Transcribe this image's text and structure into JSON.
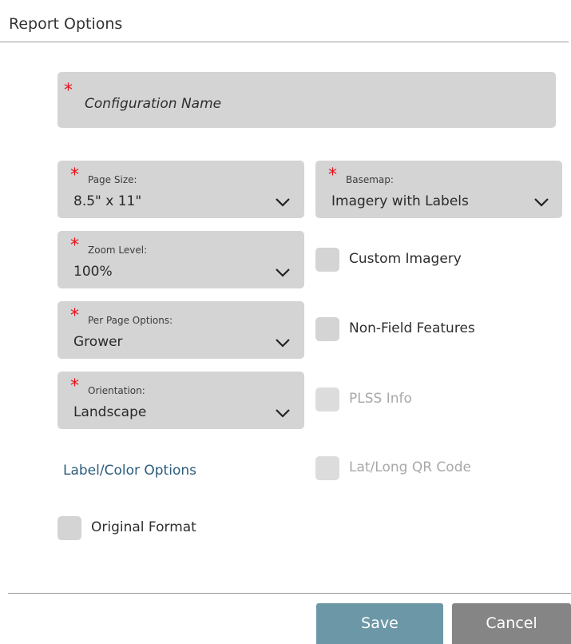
{
  "header": {
    "title": "Report Options"
  },
  "fields": {
    "config_name": {
      "required_mark": "*",
      "placeholder": "Configuration Name"
    },
    "page_size": {
      "required_mark": "*",
      "label": "Page Size:",
      "value": "8.5\" x 11\""
    },
    "basemap": {
      "required_mark": "*",
      "label": "Basemap:",
      "value": "Imagery with Labels"
    },
    "zoom_level": {
      "required_mark": "*",
      "label": "Zoom Level:",
      "value": "100%"
    },
    "per_page": {
      "required_mark": "*",
      "label": "Per Page Options:",
      "value": "Grower"
    },
    "orientation": {
      "required_mark": "*",
      "label": "Orientation:",
      "value": "Landscape"
    }
  },
  "checkboxes": {
    "custom_imagery": {
      "label": "Custom Imagery",
      "checked": false,
      "disabled": false
    },
    "non_field_features": {
      "label": "Non-Field Features",
      "checked": false,
      "disabled": false
    },
    "plss_info": {
      "label": "PLSS Info",
      "checked": false,
      "disabled": true
    },
    "lat_long_qr": {
      "label": "Lat/Long QR Code",
      "checked": false,
      "disabled": true
    },
    "original_format": {
      "label": "Original Format",
      "checked": false,
      "disabled": false
    }
  },
  "links": {
    "label_color_options": "Label/Color Options"
  },
  "footer": {
    "save_label": "Save",
    "cancel_label": "Cancel"
  },
  "colors": {
    "required": "#e8101a",
    "field_bg": "#d4d4d4",
    "link": "#2b5d7c",
    "save_button": "#6c97a6",
    "cancel_button": "#858585"
  },
  "icons": {
    "dropdown": "chevron-down-icon"
  }
}
